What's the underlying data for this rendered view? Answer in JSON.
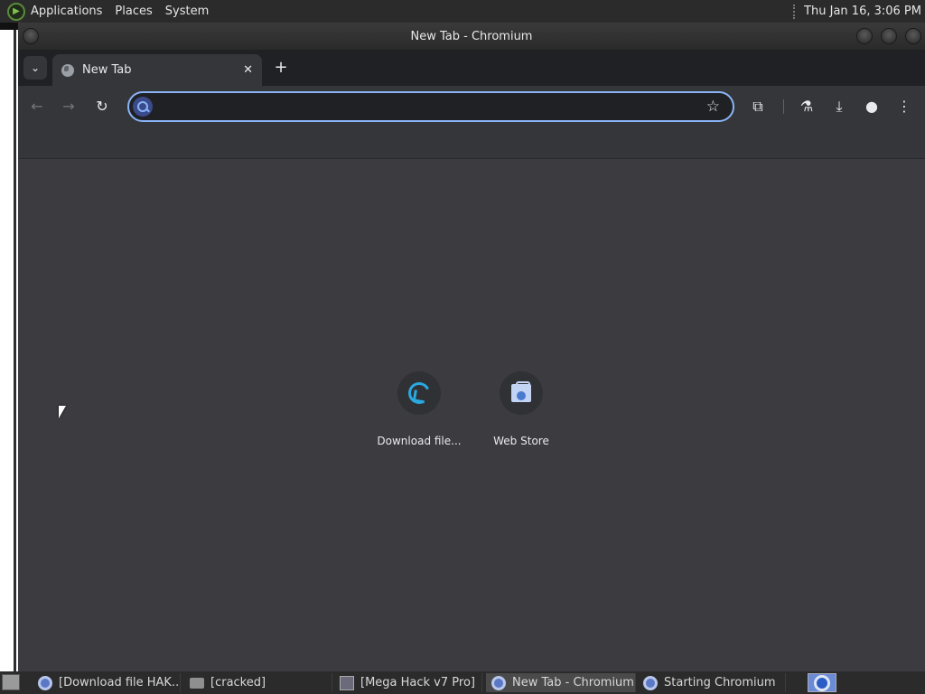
{
  "top_panel": {
    "menus": [
      "Applications",
      "Places",
      "System"
    ],
    "clock": "Thu Jan 16,  3:06 PM"
  },
  "window": {
    "title": "New Tab - Chromium"
  },
  "browser": {
    "tabs": [
      {
        "title": "New Tab",
        "active": true
      }
    ],
    "omnibox": {
      "value": "",
      "placeholder": ""
    },
    "toolbar_icons": [
      "back-icon",
      "forward-icon",
      "reload-icon",
      "bookmark-star-icon",
      "extensions-icon",
      "labs-icon",
      "download-icon",
      "profile-icon",
      "menu-icon"
    ]
  },
  "ntp": {
    "shortcuts": [
      {
        "label": "Download file...",
        "icon": "download-file-icon"
      },
      {
        "label": "Web Store",
        "icon": "web-store-icon"
      }
    ]
  },
  "taskbar": {
    "tasks": [
      {
        "label": "[Download file HAK...",
        "icon": "chromium-icon",
        "active": false
      },
      {
        "label": "[cracked]",
        "icon": "folder-icon",
        "active": false
      },
      {
        "label": "[Mega Hack v7 Pro]",
        "icon": "app-icon",
        "active": false
      },
      {
        "label": "New Tab - Chromium",
        "icon": "chromium-icon",
        "active": true
      },
      {
        "label": "Starting Chromium",
        "icon": "chromium-icon",
        "active": false
      }
    ]
  },
  "colors": {
    "omnibox_focus": "#8ab4f8",
    "ntp_background": "#3c3b40",
    "tabstrip": "#202124",
    "toolbar": "#35363a"
  }
}
